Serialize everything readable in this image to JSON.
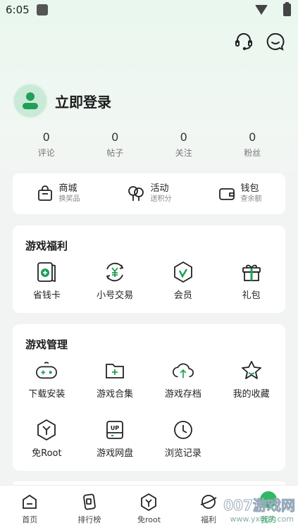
{
  "status_bar": {
    "time": "6:05"
  },
  "profile": {
    "login_label": "立即登录"
  },
  "stats": [
    {
      "value": "0",
      "label": "评论"
    },
    {
      "value": "0",
      "label": "帖子"
    },
    {
      "value": "0",
      "label": "关注"
    },
    {
      "value": "0",
      "label": "粉丝"
    }
  ],
  "quick_links": [
    {
      "title": "商城",
      "subtitle": "换奖品",
      "icon": "shopping-bag-icon"
    },
    {
      "title": "活动",
      "subtitle": "送积分",
      "icon": "balloon-icon"
    },
    {
      "title": "钱包",
      "subtitle": "查余额",
      "icon": "wallet-icon"
    }
  ],
  "game_benefits": {
    "title": "游戏福利",
    "items": [
      {
        "label": "省钱卡",
        "icon": "savings-card-icon"
      },
      {
        "label": "小号交易",
        "icon": "yuan-exchange-icon"
      },
      {
        "label": "会员",
        "icon": "vip-shield-icon"
      },
      {
        "label": "礼包",
        "icon": "gift-icon"
      }
    ]
  },
  "game_management": {
    "title": "游戏管理",
    "items": [
      {
        "label": "下载安装",
        "icon": "gamepad-icon"
      },
      {
        "label": "游戏合集",
        "icon": "folder-add-icon"
      },
      {
        "label": "游戏存档",
        "icon": "cloud-upload-icon"
      },
      {
        "label": "我的收藏",
        "icon": "star-icon"
      },
      {
        "label": "免Root",
        "icon": "root-icon"
      },
      {
        "label": "游戏网盘",
        "icon": "up-disk-icon"
      },
      {
        "label": "浏览记录",
        "icon": "clock-icon"
      }
    ]
  },
  "bottom_nav": [
    {
      "label": "首页",
      "icon": "home-icon"
    },
    {
      "label": "排行榜",
      "icon": "ranking-icon"
    },
    {
      "label": "免root",
      "icon": "root-icon"
    },
    {
      "label": "福利",
      "icon": "planet-icon"
    },
    {
      "label": "我的",
      "icon": "profile-icon"
    }
  ],
  "watermark": {
    "text": "007游戏网",
    "url": "www.yx007.com"
  },
  "colors": {
    "accent": "#2fb865",
    "icon": "#222222",
    "background": "#f2f3f3"
  }
}
